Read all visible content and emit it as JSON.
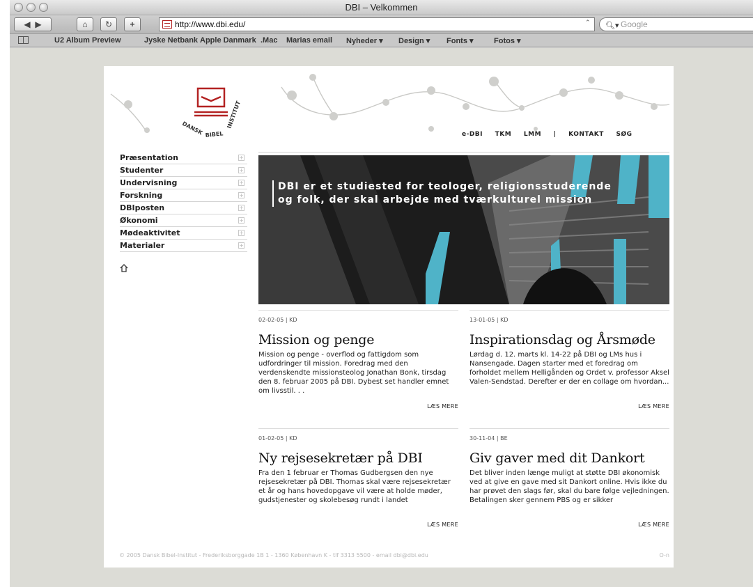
{
  "browser": {
    "title": "DBI – Velkommen",
    "url": "http://www.dbi.edu/",
    "search_placeholder": "Google",
    "bookmarks": [
      "U2 Album Preview",
      "Jyske Netbank",
      "Apple Danmark",
      ".Mac",
      "Marias email",
      "Nyheder ▾",
      "Design ▾",
      "Fonts ▾",
      "Fotos ▾"
    ]
  },
  "site": {
    "logo_text": "DANSK BIBEL INSTITUT",
    "topnav": [
      "e-DBI",
      "TKM",
      "LMM",
      "|",
      "KONTAKT",
      "SØG"
    ],
    "menu": [
      "Præsentation",
      "Studenter",
      "Undervisning",
      "Forskning",
      "DBIposten",
      "Økonomi",
      "Mødeaktivitet",
      "Materialer"
    ],
    "hero": {
      "line1": "DBI er et studiested for teologer, religionsstuderende",
      "line2": "og folk, der skal arbejde med tværkulturel mission"
    },
    "articles": [
      {
        "meta": "02-02-05 | KD",
        "title": "Mission og penge",
        "body": "Mission og penge - overflod og fattigdom som udfordringer til mission. Foredrag med den verdenskendte missionsteolog Jonathan Bonk, tirsdag den 8. februar 2005 på DBI. Dybest set handler emnet om livsstil. . .",
        "more": "LÆS MERE"
      },
      {
        "meta": "13-01-05 | KD",
        "title": "Inspirationsdag og Årsmøde",
        "body": "Lørdag d. 12. marts kl. 14-22 på DBI og LMs hus i Nansengade. Dagen starter med et foredrag om forholdet mellem Helligånden og Ordet v. professor Aksel Valen-Sendstad. Derefter er der en collage om hvordan...",
        "more": "LÆS MERE"
      },
      {
        "meta": "01-02-05 | KD",
        "title": "Ny rejsesekretær på DBI",
        "body": "Fra den 1 februar er Thomas Gudbergsen den nye rejsesekretær på DBI. Thomas skal være rejsesekretær et år og hans hovedopgave vil være at holde møder, gudstjenester og skolebesøg rundt i landet",
        "more": "LÆS MERE"
      },
      {
        "meta": "30-11-04 | BE",
        "title": "Giv gaver med dit Dankort",
        "body": "Det bliver inden længe muligt at støtte DBI økonomisk ved at give en gave med sit Dankort online. Hvis ikke du har prøvet den slags før, skal du bare følge vejledningen. Betalingen sker gennem PBS og er sikker",
        "more": "LÆS MERE"
      }
    ],
    "footer": "© 2005 Dansk Bibel-Institut - Frederiksborggade 1B 1 - 1360 København K - tlf 3313 5500 - email dbi@dbi.edu",
    "footer_key": "O-n"
  },
  "colors": {
    "brand_red": "#b32222",
    "hero_cyan": "#4fb3c8"
  }
}
